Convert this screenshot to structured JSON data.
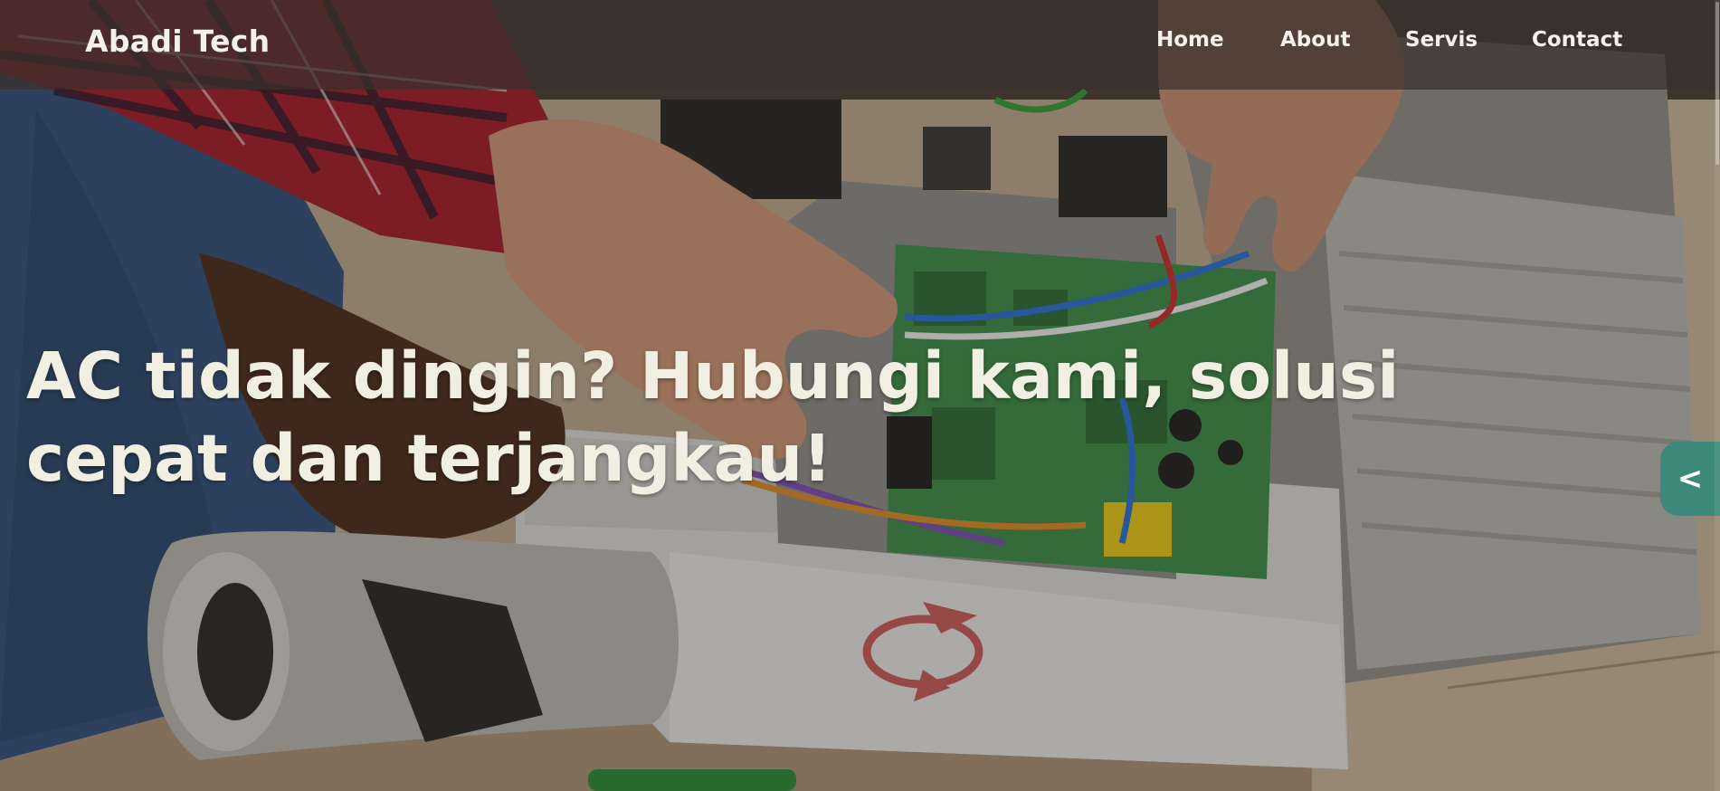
{
  "navbar": {
    "brand": "Abadi Tech",
    "links": [
      {
        "label": "Home"
      },
      {
        "label": "About"
      },
      {
        "label": "Servis"
      },
      {
        "label": "Contact"
      }
    ]
  },
  "hero": {
    "headline": "AC tidak dingin? Hubungi kami, solusi cepat dan terjangkau!",
    "background": "technician-repairing-ac-unit-photo"
  },
  "side_toggle": {
    "label": "<",
    "color": "#3d8a7c"
  }
}
